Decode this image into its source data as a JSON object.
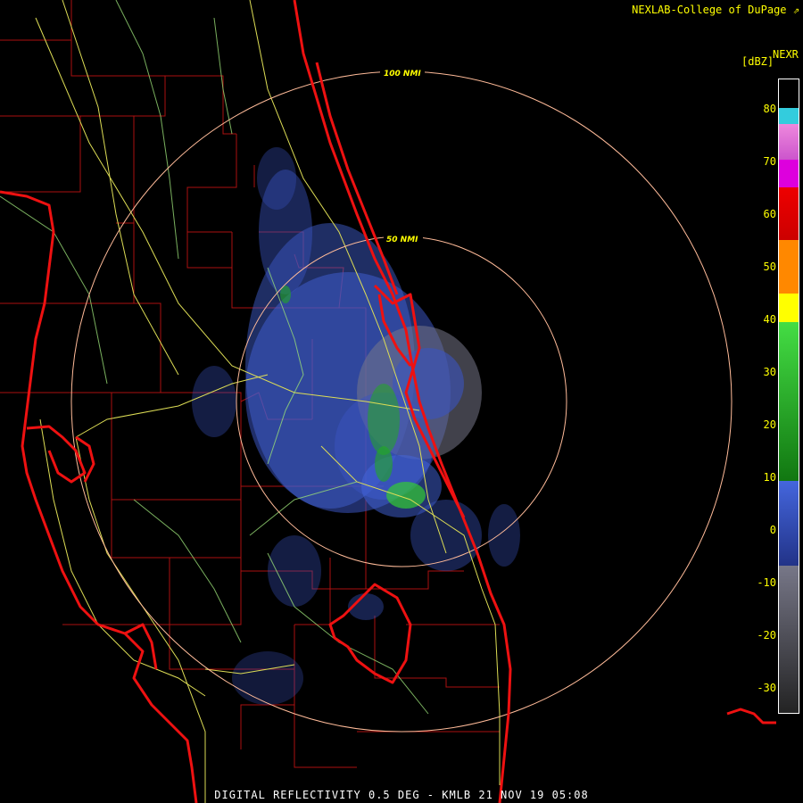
{
  "credit": "NEXLAB-College of DuPage",
  "credit_icon": "external-link-icon",
  "product_code": "NEXR",
  "units": "[dBZ]",
  "scale": {
    "ticks": [
      "80",
      "70",
      "60",
      "50",
      "40",
      "30",
      "20",
      "10",
      "0",
      "-10",
      "-20",
      "-30"
    ],
    "colors": {
      "cyan": "#33ccdd",
      "pink": "#ee88dd",
      "magenta": "#dd00dd",
      "red": "#ee0000",
      "orange": "#ff8800",
      "yellow": "#ffff00",
      "green_light": "#44dd44",
      "green_dark": "#117711",
      "blue_light": "#4466dd",
      "blue_dark": "#223388",
      "gray_light": "#777788",
      "gray_dark": "#222222"
    }
  },
  "rings": [
    {
      "label": "100 NMI"
    },
    {
      "label": "50 NMI"
    }
  ],
  "footer": "DIGITAL REFLECTIVITY 0.5 DEG - KMLB 21 NOV 19 05:08",
  "colors": {
    "coast": "#ee1111",
    "county": "#aa1111",
    "road": "#dddd55",
    "road_alt": "#99dd77",
    "ring": "#ffbb99"
  }
}
